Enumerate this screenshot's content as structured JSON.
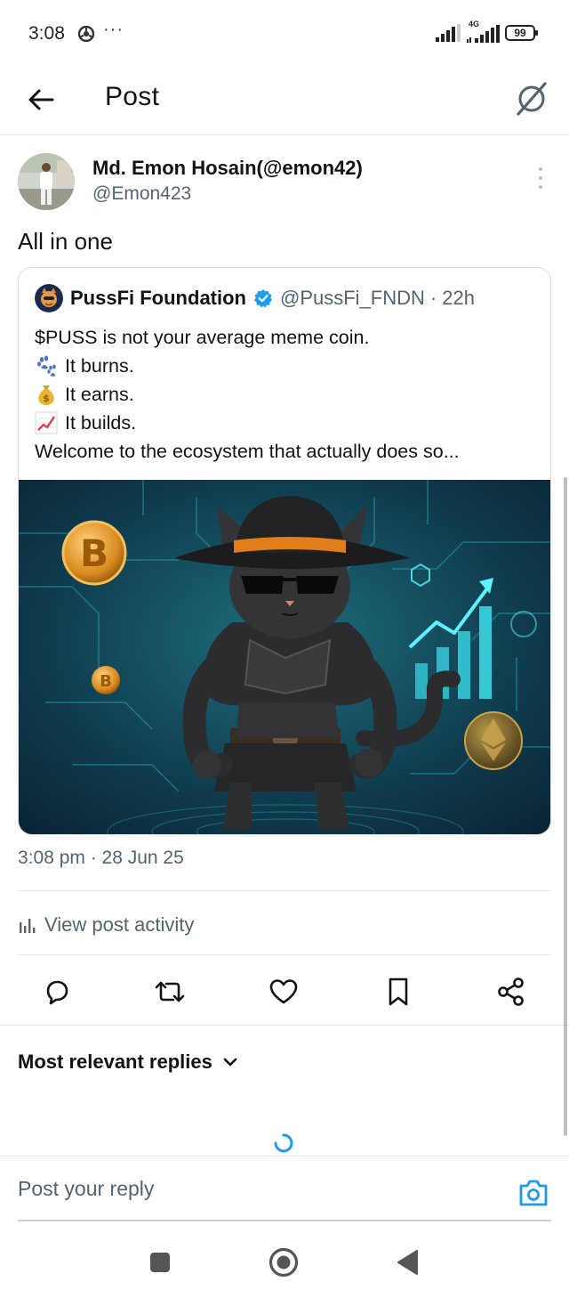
{
  "status_bar": {
    "time": "3:08",
    "more": "···",
    "network": "4G",
    "battery": "99"
  },
  "header": {
    "title": "Post"
  },
  "post": {
    "author_name": "Md. Emon Hosain(@emon42)",
    "author_handle": "@Emon423",
    "text": "All in one",
    "timestamp": "3:08 pm · 28 Jun 25"
  },
  "quote": {
    "name": "PussFi Foundation",
    "handle": "@PussFi_FNDN",
    "separator": "·",
    "time": "22h",
    "lines": [
      {
        "emoji": "",
        "text": "$PUSS is not your average meme coin."
      },
      {
        "emoji": "paw-prints-icon",
        "text": "It burns."
      },
      {
        "emoji": "money-bag-icon",
        "text": "It earns."
      },
      {
        "emoji": "chart-increasing-icon",
        "text": "It builds."
      },
      {
        "emoji": "",
        "text": "Welcome to the ecosystem that actually does so..."
      }
    ],
    "image_alt": "Cat in black hat, sunglasses and armor with crypto coins and rising chart"
  },
  "activity": {
    "label": "View post activity"
  },
  "replies": {
    "sort_label": "Most relevant replies"
  },
  "reply_bar": {
    "placeholder": "Post your reply"
  },
  "colors": {
    "accent": "#1d9bf0",
    "text": "#0f1419",
    "muted": "#536471"
  }
}
